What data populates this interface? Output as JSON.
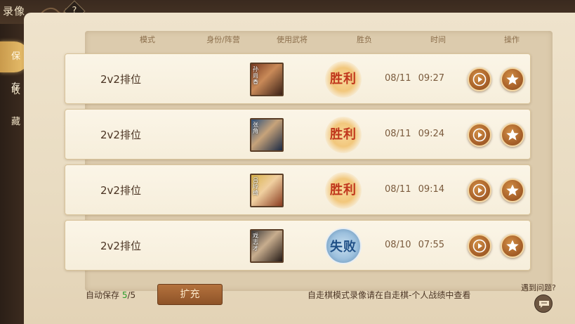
{
  "header": {
    "title": "录像",
    "help": "?"
  },
  "sidebar": {
    "items": [
      {
        "label": "保存",
        "active": true
      },
      {
        "label": "收藏",
        "active": false
      }
    ]
  },
  "table": {
    "columns": [
      "模式",
      "身份/阵营",
      "使用武将",
      "胜负",
      "时间",
      "操作"
    ],
    "rows": [
      {
        "mode": "2v2排位",
        "hero_tag": "孙尚香",
        "result": "胜利",
        "result_type": "win",
        "time": "08/11 09:27"
      },
      {
        "mode": "2v2排位",
        "hero_tag": "张角",
        "result": "胜利",
        "result_type": "win",
        "time": "08/11 09:24"
      },
      {
        "mode": "2v2排位",
        "hero_tag": "吕玲绮",
        "result": "胜利",
        "result_type": "win",
        "time": "08/11 09:14"
      },
      {
        "mode": "2v2排位",
        "hero_tag": "戏志才",
        "result": "失败",
        "result_type": "lose",
        "time": "08/10 07:55"
      }
    ]
  },
  "footer": {
    "auto_save_label": "自动保存",
    "auto_save_used": "5",
    "auto_save_total": "/5",
    "expand_label": "扩充",
    "note": "自走棋模式录像请在自走棋-个人战绩中查看",
    "problem_label": "遇到问题?"
  },
  "colors": {
    "win_text": "#c0371d",
    "lose_text": "#1f4f86",
    "accent_button": "#a9622a",
    "count_green": "#2a9b2a"
  }
}
